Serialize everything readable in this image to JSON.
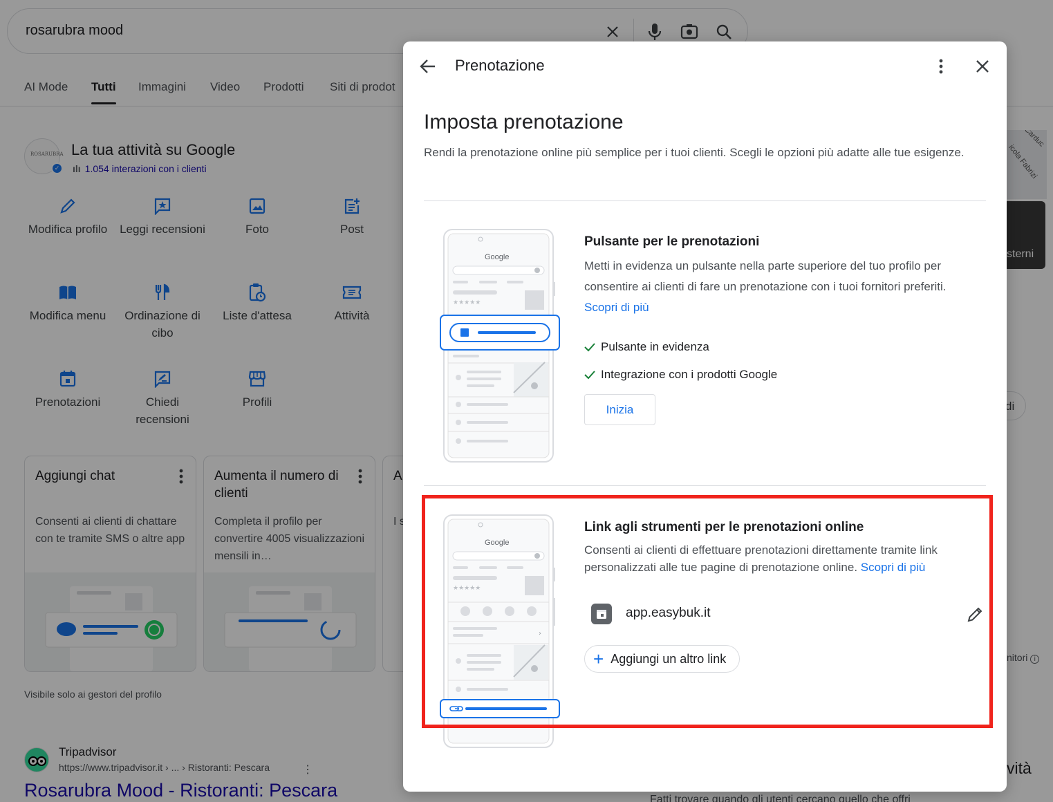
{
  "search": {
    "query": "rosarubra mood"
  },
  "tabs": [
    "AI Mode",
    "Tutti",
    "Immagini",
    "Video",
    "Prodotti",
    "Siti di prodot"
  ],
  "business": {
    "title": "La tua attività su Google",
    "stats": "1.054 interazioni con i clienti",
    "logo_text": "ROSARUBRA"
  },
  "actions": [
    {
      "label": "Modifica profilo",
      "icon": "pencil-icon"
    },
    {
      "label": "Leggi recensioni",
      "icon": "review-star-icon"
    },
    {
      "label": "Foto",
      "icon": "photo-icon"
    },
    {
      "label": "Post",
      "icon": "post-add-icon"
    },
    {
      "label": "Modifica menu",
      "icon": "menu-book-icon"
    },
    {
      "label": "Ordinazione di cibo",
      "icon": "fork-knife-icon"
    },
    {
      "label": "Liste d'attesa",
      "icon": "waitlist-clipboard-icon"
    },
    {
      "label": "Attività",
      "icon": "ticket-icon"
    },
    {
      "label": "Prenotazioni",
      "icon": "calendar-icon"
    },
    {
      "label": "Chiedi recensioni",
      "icon": "request-review-icon"
    },
    {
      "label": "Profili",
      "icon": "storefront-icon"
    }
  ],
  "cards": [
    {
      "title": "Aggiungi chat",
      "desc": "Consenti ai clienti di chattare con te tramite SMS o altre app"
    },
    {
      "title": "Aumenta il numero di clienti",
      "desc": "Completa il profilo per convertire 4005 visualizzazioni mensili in…"
    },
    {
      "title": "A tu",
      "desc": "I su de"
    }
  ],
  "visibility_note": "Visibile solo ai gestori del profilo",
  "result": {
    "site_name": "Tripadvisor",
    "url": "https://www.tripadvisor.it › ... › Ristoranti: Pescara",
    "title": "Rosarubra Mood - Ristoranti: Pescara"
  },
  "right_fragments": {
    "road1": "Carduc",
    "road2": "icola Fabrizi",
    "photo_label": "sterni",
    "chip": "di",
    "fornitori": "nitori",
    "attivita": "vità",
    "bottom": "Fatti trovare quando gli utenti cercano quello che offri"
  },
  "dialog": {
    "title": "Prenotazione",
    "heading": "Imposta prenotazione",
    "intro": "Rendi la prenotazione online più semplice per i tuoi clienti. Scegli le opzioni più adatte alle tue esigenze.",
    "section1": {
      "title": "Pulsante per le prenotazioni",
      "desc": "Metti in evidenza un pulsante nella parte superiore del tuo profilo per consentire ai clienti di fare un prenotazione con i tuoi fornitori preferiti.",
      "learn_more": "Scopri di più",
      "features": [
        "Pulsante in evidenza",
        "Integrazione con i prodotti Google"
      ],
      "button": "Inizia"
    },
    "section2": {
      "title": "Link agli strumenti per le prenotazioni online",
      "desc": "Consenti ai clienti di effettuare prenotazioni direttamente tramite link personalizzati alle tue pagine di prenotazione online.",
      "learn_more": "Scopri di più",
      "link": "app.easybuk.it",
      "add_button": "Aggiungi un altro link"
    },
    "phone_brand": "Google",
    "phone_rating": "★★★★★"
  },
  "colors": {
    "accent": "#1a73e8",
    "highlight": "#f0231c",
    "check": "#188038"
  }
}
